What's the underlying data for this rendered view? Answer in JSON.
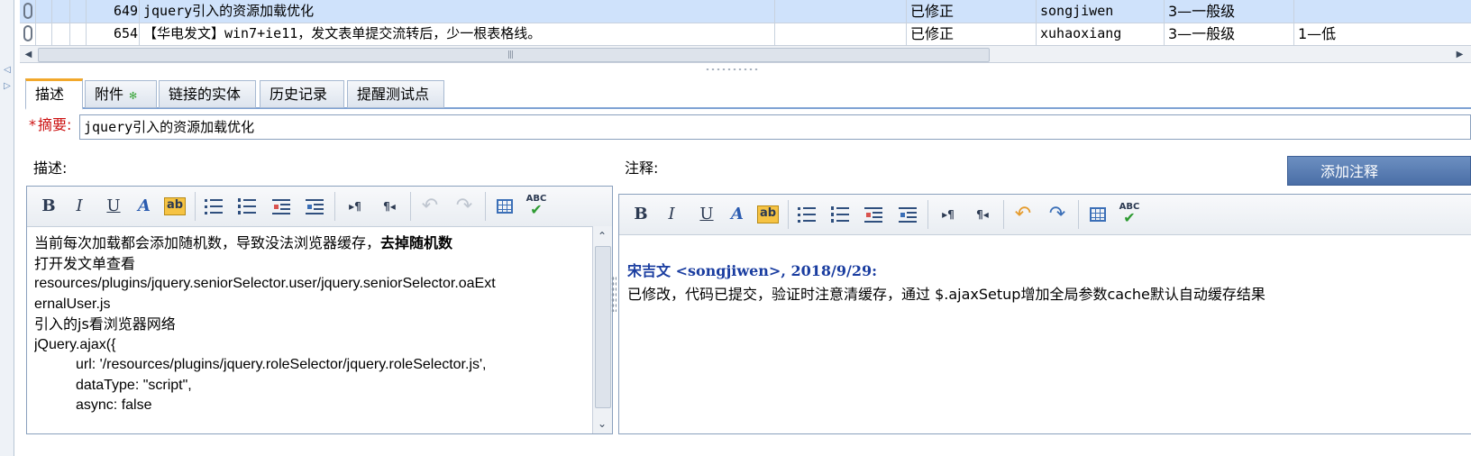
{
  "grid": {
    "rows": [
      {
        "id": "649",
        "title": "jquery引入的资源加载优化",
        "status": "已修正",
        "owner": "songjiwen",
        "severity": "3—一般级",
        "priority": ""
      },
      {
        "id": "654",
        "title": "【华电发文】win7+ie11，发文表单提交流转后，少一根表格线。",
        "status": "已修正",
        "owner": "xuhaoxiang",
        "severity": "3—一般级",
        "priority": "1—低"
      }
    ]
  },
  "tabs": [
    {
      "label": "描述"
    },
    {
      "label": "附件",
      "badge": "✻"
    },
    {
      "label": "链接的实体"
    },
    {
      "label": "历史记录"
    },
    {
      "label": "提醒测试点"
    }
  ],
  "summary": {
    "required_mark": "*",
    "label": "摘要:",
    "value": "jquery引入的资源加载优化"
  },
  "description": {
    "label": "描述:",
    "line1_normal": "当前每次加载都会添加随机数，导致没法浏览器缓存，",
    "line1_bold": "去掉随机数",
    "line2": "打开发文单查看",
    "line3": "resources/plugins/jquery.seniorSelector.user/jquery.seniorSelector.oaExt",
    "line4": "ernalUser.js",
    "line5": "引入的js看浏览器网络",
    "line6": "jQuery.ajax({",
    "line7": "url: '/resources/plugins/jquery.roleSelector/jquery.roleSelector.js',",
    "line8": "dataType: \"script\",",
    "line9": "async: false"
  },
  "notes": {
    "label": "注释:",
    "add_button": "添加注释",
    "entry_header": "宋吉文 <songjiwen>, 2018/9/29:",
    "entry_text": "已修改，代码已提交，验证时注意清缓存，通过 $.ajaxSetup增加全局参数cache默认自动缓存结果"
  },
  "toolbar": {
    "bold": "B",
    "italic": "I",
    "underline": "U",
    "font_color": "A",
    "highlight": "ab",
    "ltr": "▸¶",
    "rtl": "¶◂",
    "undo": "↶",
    "redo": "↷",
    "spell": "ABC"
  },
  "icons": [
    "attachment-icon",
    "scroll-left-icon",
    "scroll-right-icon",
    "bullet-list-icon",
    "numbered-list-icon",
    "outdent-icon",
    "indent-icon",
    "table-icon",
    "spellcheck-icon"
  ],
  "colors": {
    "selected_row": "#cfe2fb",
    "tab_accent": "#f2a82b",
    "required": "#cc1111",
    "note_author": "#1a3da0",
    "button": "#5a7fb5"
  }
}
